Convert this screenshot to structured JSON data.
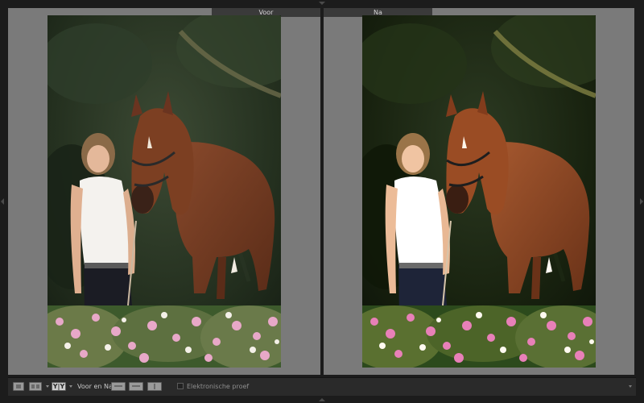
{
  "window": {
    "before_label": "Voor",
    "after_label": "Na"
  },
  "toolbar": {
    "view_mode_label": "Voor en Na:",
    "yy_label": "Y|Y",
    "proof_label": "Elektronische proef"
  },
  "icons": {
    "loupe": "loupe-view-icon",
    "grid": "grid-view-icon",
    "before_after": "before-after-icon",
    "swap": "swap-icon",
    "copy_before": "copy-before-icon",
    "copy_after": "copy-after-icon"
  },
  "colors": {
    "panel_background": "#7a7a7a",
    "app_background": "#1c1c1c",
    "toolbar_background": "#2a2a2a"
  }
}
